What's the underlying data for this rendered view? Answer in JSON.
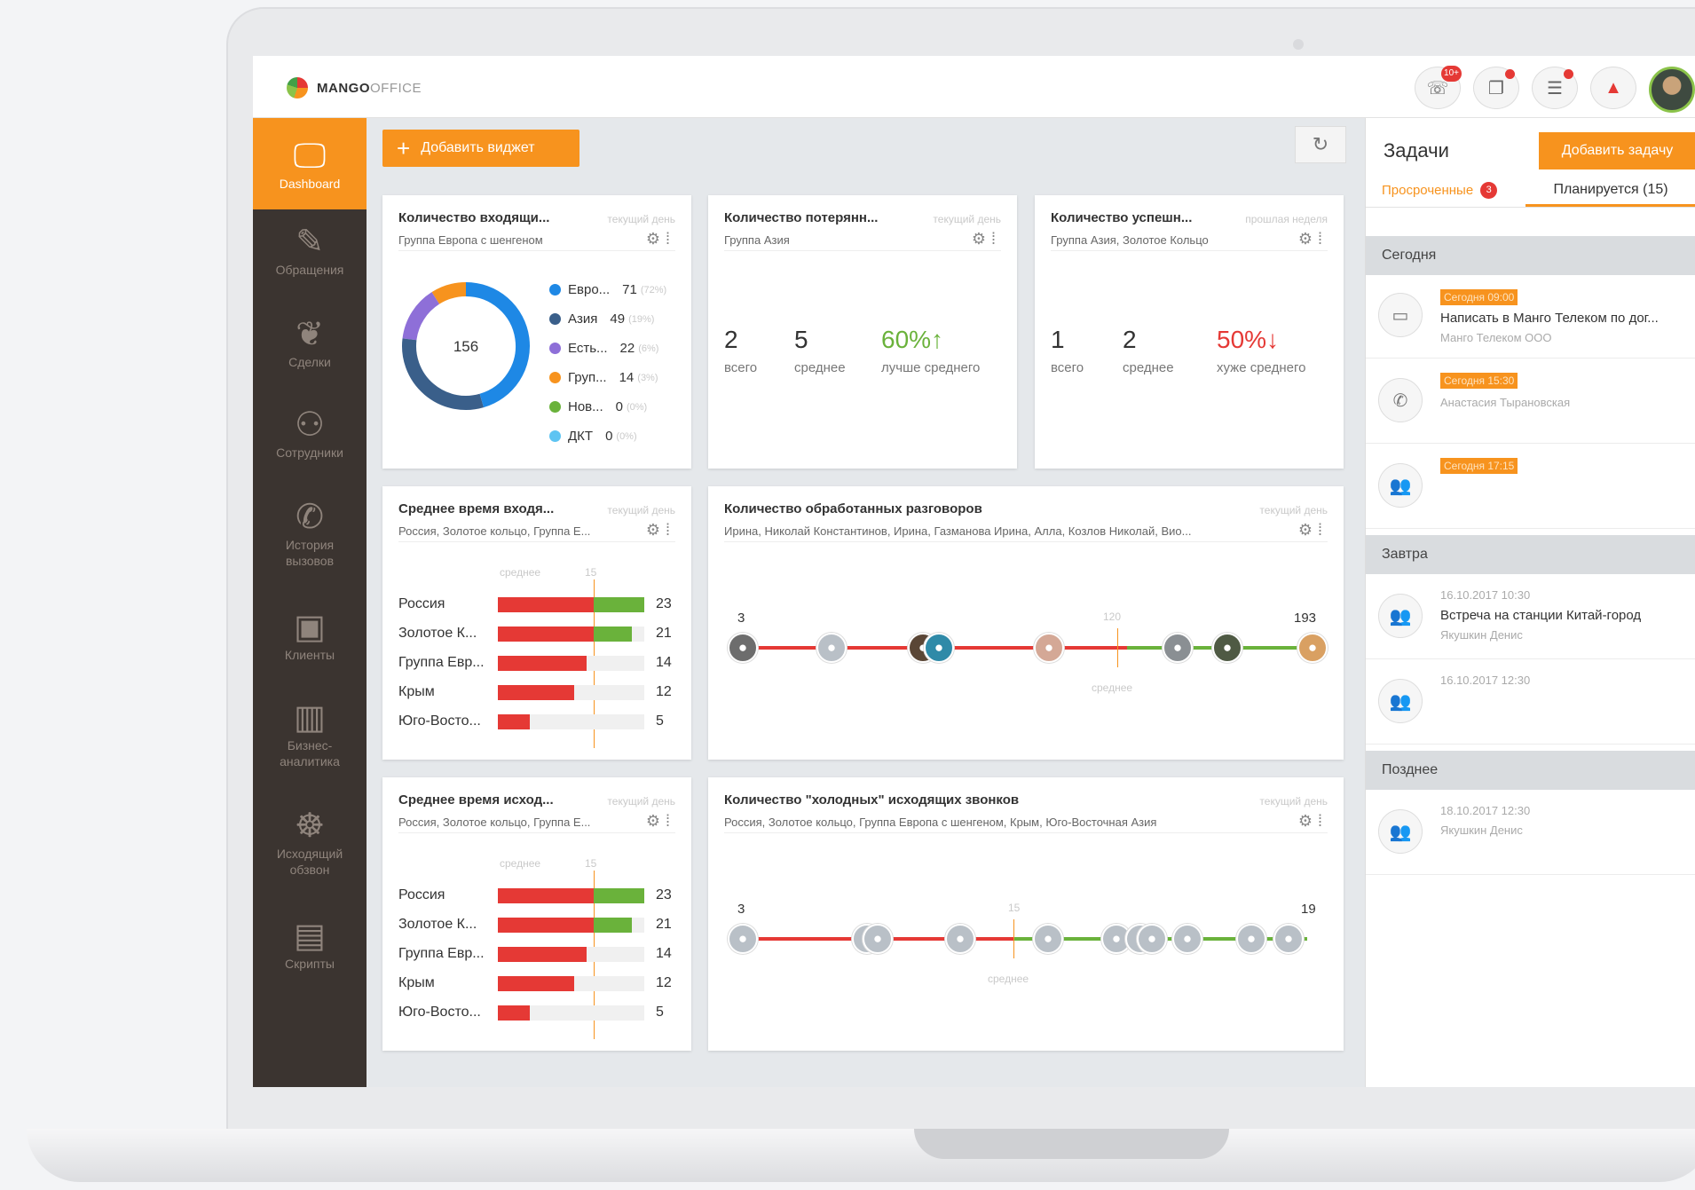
{
  "logo": {
    "bold": "MANGO",
    "light": "OFFICE"
  },
  "topbar": {
    "icons": [
      {
        "name": "missed-calls-icon",
        "glyph": "☏",
        "badge": "10+"
      },
      {
        "name": "copy-icon",
        "glyph": "❐",
        "badge": ""
      },
      {
        "name": "list-icon",
        "glyph": "☰",
        "badge": ""
      },
      {
        "name": "bell-icon",
        "glyph": "🔔",
        "badge": ""
      }
    ]
  },
  "sidebar": {
    "active": {
      "label": "Dashboard",
      "icon": "dashboard-icon"
    },
    "items": [
      {
        "label": "Обращения",
        "icon": "requests-icon"
      },
      {
        "label": "Сделки",
        "icon": "deals-icon"
      },
      {
        "label": "Сотрудники",
        "icon": "employees-icon"
      },
      {
        "label": "История вызовов",
        "icon": "call-history-icon"
      },
      {
        "label": "Клиенты",
        "icon": "clients-icon"
      },
      {
        "label": "Бизнес-аналитика",
        "icon": "analytics-icon"
      },
      {
        "label": "Исходящий обзвон",
        "icon": "octopus-icon"
      },
      {
        "label": "Скрипты",
        "icon": "scripts-icon"
      }
    ]
  },
  "toolbar": {
    "add_widget": "Добавить виджет"
  },
  "widgets": {
    "incoming": {
      "title": "Количество входящи...",
      "period": "текущий день",
      "subtitle": "Группа Европа с шенгеном",
      "total": "156",
      "legend": [
        {
          "name": "Евро...",
          "value": "71",
          "pct": "(72%)",
          "color": "#1e88e5"
        },
        {
          "name": "Азия",
          "value": "49",
          "pct": "(19%)",
          "color": "#3a5f8a"
        },
        {
          "name": "Есть...",
          "value": "22",
          "pct": "(6%)",
          "color": "#8e6fd8"
        },
        {
          "name": "Груп...",
          "value": "14",
          "pct": "(3%)",
          "color": "#f7931e"
        },
        {
          "name": "Нов...",
          "value": "0",
          "pct": "(0%)",
          "color": "#6ab23b"
        },
        {
          "name": "ДКТ",
          "value": "0",
          "pct": "(0%)",
          "color": "#5ec4f2"
        }
      ]
    },
    "lost": {
      "title": "Количество потерянн...",
      "period": "текущий день",
      "subtitle": "Группа Азия",
      "total": "2",
      "total_label": "всего",
      "avg": "5",
      "avg_label": "среднее",
      "pct": "60%↑",
      "pct_label": "лучше среднего"
    },
    "success": {
      "title": "Количество успешн...",
      "period": "прошлая неделя",
      "subtitle": "Группа Азия, Золотое Кольцо",
      "total": "1",
      "total_label": "всего",
      "avg": "2",
      "avg_label": "среднее",
      "pct": "50%↓",
      "pct_label": "хуже среднего"
    },
    "avg_in": {
      "title": "Среднее время входя...",
      "period": "текущий день",
      "subtitle": "Россия, Золотое кольцо, Группа Е...",
      "avg_label": "среднее",
      "avg_value": "15"
    },
    "avg_out": {
      "title": "Среднее время исход...",
      "period": "текущий день",
      "subtitle": "Россия, Золотое кольцо, Группа Е...",
      "avg_label": "среднее",
      "avg_value": "15"
    },
    "processed": {
      "title": "Количество обработанных разговоров",
      "period": "текущий день",
      "subtitle": "Ирина, Николай Константинов, Ирина, Газманова Ирина, Алла, Козлов Николай, Вио...",
      "min": "3",
      "max": "193",
      "mark": "120",
      "avg_label": "среднее"
    },
    "cold": {
      "title": "Количество \"холодных\" исходящих звонков",
      "period": "текущий день",
      "subtitle": "Россия, Золотое кольцо, Группа Европа с шенгеном, Крым, Юго-Восточная Азия",
      "min": "3",
      "max": "19",
      "mark": "15",
      "avg_label": "среднее"
    }
  },
  "chart_data": [
    {
      "type": "pie",
      "title": "Количество входящи...",
      "center_label": "156",
      "categories": [
        "Евро...",
        "Азия",
        "Есть...",
        "Груп...",
        "Нов...",
        "ДКТ"
      ],
      "values": [
        71,
        49,
        22,
        14,
        0,
        0
      ]
    },
    {
      "type": "bar",
      "title": "Среднее время входя...",
      "categories": [
        "Россия",
        "Золотое К...",
        "Группа Евр...",
        "Крым",
        "Юго-Восто..."
      ],
      "values": [
        23,
        21,
        14,
        12,
        5
      ],
      "average": 15,
      "xlim": [
        0,
        23
      ]
    },
    {
      "type": "bar",
      "title": "Среднее время исход...",
      "categories": [
        "Россия",
        "Золотое К...",
        "Группа Евр...",
        "Крым",
        "Юго-Восто..."
      ],
      "values": [
        23,
        21,
        14,
        12,
        5
      ],
      "average": 15,
      "xlim": [
        0,
        23
      ]
    }
  ],
  "tasks": {
    "title": "Задачи",
    "add": "Добавить задачу",
    "tab_overdue": "Просроченные",
    "overdue_count": "3",
    "tab_planned": "Планируется (15)",
    "groups": [
      {
        "label": "Сегодня",
        "items": [
          {
            "icon": "message-icon",
            "glyph": "▭",
            "tag": "Сегодня 09:00",
            "text": "Написать в Манго Телеком по дог...",
            "meta": "Манго Телеком ООО"
          },
          {
            "icon": "phone-icon",
            "glyph": "✆",
            "tag": "Сегодня 15:30",
            "text": "",
            "meta": "Анастасия Тырановская"
          },
          {
            "icon": "meeting-icon",
            "glyph": "👥",
            "tag": "Сегодня 17:15",
            "text": "",
            "meta": ""
          }
        ]
      },
      {
        "label": "Завтра",
        "items": [
          {
            "icon": "meeting-icon",
            "glyph": "👥",
            "date": "16.10.2017 10:30",
            "text": "Встреча на станции Китай-город",
            "meta": "Якушкин Денис"
          },
          {
            "icon": "meeting-icon",
            "glyph": "👥",
            "date": "16.10.2017 12:30",
            "text": "",
            "meta": ""
          }
        ]
      },
      {
        "label": "Позднее",
        "items": [
          {
            "icon": "meeting-icon",
            "glyph": "👥",
            "date": "18.10.2017 12:30",
            "text": "",
            "meta": "Якушкин Денис"
          }
        ]
      }
    ]
  },
  "colors": {
    "accent": "#f7931e",
    "sidebar": "#3b3430",
    "red": "#e53935",
    "green": "#6ab23b"
  }
}
